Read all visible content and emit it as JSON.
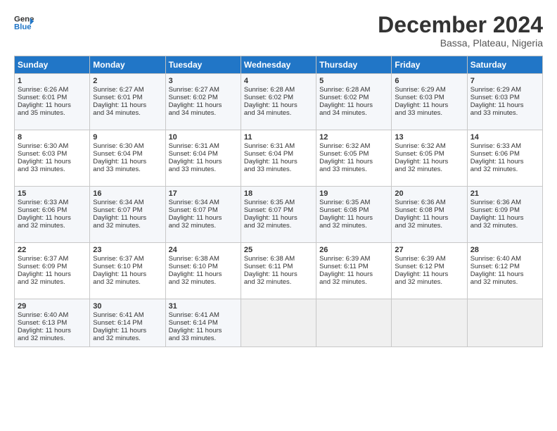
{
  "header": {
    "logo_line1": "General",
    "logo_line2": "Blue",
    "month": "December 2024",
    "location": "Bassa, Plateau, Nigeria"
  },
  "days_of_week": [
    "Sunday",
    "Monday",
    "Tuesday",
    "Wednesday",
    "Thursday",
    "Friday",
    "Saturday"
  ],
  "weeks": [
    [
      {
        "day": "1",
        "lines": [
          "Sunrise: 6:26 AM",
          "Sunset: 6:01 PM",
          "Daylight: 11 hours",
          "and 35 minutes."
        ]
      },
      {
        "day": "2",
        "lines": [
          "Sunrise: 6:27 AM",
          "Sunset: 6:01 PM",
          "Daylight: 11 hours",
          "and 34 minutes."
        ]
      },
      {
        "day": "3",
        "lines": [
          "Sunrise: 6:27 AM",
          "Sunset: 6:02 PM",
          "Daylight: 11 hours",
          "and 34 minutes."
        ]
      },
      {
        "day": "4",
        "lines": [
          "Sunrise: 6:28 AM",
          "Sunset: 6:02 PM",
          "Daylight: 11 hours",
          "and 34 minutes."
        ]
      },
      {
        "day": "5",
        "lines": [
          "Sunrise: 6:28 AM",
          "Sunset: 6:02 PM",
          "Daylight: 11 hours",
          "and 34 minutes."
        ]
      },
      {
        "day": "6",
        "lines": [
          "Sunrise: 6:29 AM",
          "Sunset: 6:03 PM",
          "Daylight: 11 hours",
          "and 33 minutes."
        ]
      },
      {
        "day": "7",
        "lines": [
          "Sunrise: 6:29 AM",
          "Sunset: 6:03 PM",
          "Daylight: 11 hours",
          "and 33 minutes."
        ]
      }
    ],
    [
      {
        "day": "8",
        "lines": [
          "Sunrise: 6:30 AM",
          "Sunset: 6:03 PM",
          "Daylight: 11 hours",
          "and 33 minutes."
        ]
      },
      {
        "day": "9",
        "lines": [
          "Sunrise: 6:30 AM",
          "Sunset: 6:04 PM",
          "Daylight: 11 hours",
          "and 33 minutes."
        ]
      },
      {
        "day": "10",
        "lines": [
          "Sunrise: 6:31 AM",
          "Sunset: 6:04 PM",
          "Daylight: 11 hours",
          "and 33 minutes."
        ]
      },
      {
        "day": "11",
        "lines": [
          "Sunrise: 6:31 AM",
          "Sunset: 6:04 PM",
          "Daylight: 11 hours",
          "and 33 minutes."
        ]
      },
      {
        "day": "12",
        "lines": [
          "Sunrise: 6:32 AM",
          "Sunset: 6:05 PM",
          "Daylight: 11 hours",
          "and 33 minutes."
        ]
      },
      {
        "day": "13",
        "lines": [
          "Sunrise: 6:32 AM",
          "Sunset: 6:05 PM",
          "Daylight: 11 hours",
          "and 32 minutes."
        ]
      },
      {
        "day": "14",
        "lines": [
          "Sunrise: 6:33 AM",
          "Sunset: 6:06 PM",
          "Daylight: 11 hours",
          "and 32 minutes."
        ]
      }
    ],
    [
      {
        "day": "15",
        "lines": [
          "Sunrise: 6:33 AM",
          "Sunset: 6:06 PM",
          "Daylight: 11 hours",
          "and 32 minutes."
        ]
      },
      {
        "day": "16",
        "lines": [
          "Sunrise: 6:34 AM",
          "Sunset: 6:07 PM",
          "Daylight: 11 hours",
          "and 32 minutes."
        ]
      },
      {
        "day": "17",
        "lines": [
          "Sunrise: 6:34 AM",
          "Sunset: 6:07 PM",
          "Daylight: 11 hours",
          "and 32 minutes."
        ]
      },
      {
        "day": "18",
        "lines": [
          "Sunrise: 6:35 AM",
          "Sunset: 6:07 PM",
          "Daylight: 11 hours",
          "and 32 minutes."
        ]
      },
      {
        "day": "19",
        "lines": [
          "Sunrise: 6:35 AM",
          "Sunset: 6:08 PM",
          "Daylight: 11 hours",
          "and 32 minutes."
        ]
      },
      {
        "day": "20",
        "lines": [
          "Sunrise: 6:36 AM",
          "Sunset: 6:08 PM",
          "Daylight: 11 hours",
          "and 32 minutes."
        ]
      },
      {
        "day": "21",
        "lines": [
          "Sunrise: 6:36 AM",
          "Sunset: 6:09 PM",
          "Daylight: 11 hours",
          "and 32 minutes."
        ]
      }
    ],
    [
      {
        "day": "22",
        "lines": [
          "Sunrise: 6:37 AM",
          "Sunset: 6:09 PM",
          "Daylight: 11 hours",
          "and 32 minutes."
        ]
      },
      {
        "day": "23",
        "lines": [
          "Sunrise: 6:37 AM",
          "Sunset: 6:10 PM",
          "Daylight: 11 hours",
          "and 32 minutes."
        ]
      },
      {
        "day": "24",
        "lines": [
          "Sunrise: 6:38 AM",
          "Sunset: 6:10 PM",
          "Daylight: 11 hours",
          "and 32 minutes."
        ]
      },
      {
        "day": "25",
        "lines": [
          "Sunrise: 6:38 AM",
          "Sunset: 6:11 PM",
          "Daylight: 11 hours",
          "and 32 minutes."
        ]
      },
      {
        "day": "26",
        "lines": [
          "Sunrise: 6:39 AM",
          "Sunset: 6:11 PM",
          "Daylight: 11 hours",
          "and 32 minutes."
        ]
      },
      {
        "day": "27",
        "lines": [
          "Sunrise: 6:39 AM",
          "Sunset: 6:12 PM",
          "Daylight: 11 hours",
          "and 32 minutes."
        ]
      },
      {
        "day": "28",
        "lines": [
          "Sunrise: 6:40 AM",
          "Sunset: 6:12 PM",
          "Daylight: 11 hours",
          "and 32 minutes."
        ]
      }
    ],
    [
      {
        "day": "29",
        "lines": [
          "Sunrise: 6:40 AM",
          "Sunset: 6:13 PM",
          "Daylight: 11 hours",
          "and 32 minutes."
        ]
      },
      {
        "day": "30",
        "lines": [
          "Sunrise: 6:41 AM",
          "Sunset: 6:14 PM",
          "Daylight: 11 hours",
          "and 32 minutes."
        ]
      },
      {
        "day": "31",
        "lines": [
          "Sunrise: 6:41 AM",
          "Sunset: 6:14 PM",
          "Daylight: 11 hours",
          "and 33 minutes."
        ]
      },
      {
        "day": "",
        "lines": []
      },
      {
        "day": "",
        "lines": []
      },
      {
        "day": "",
        "lines": []
      },
      {
        "day": "",
        "lines": []
      }
    ]
  ]
}
